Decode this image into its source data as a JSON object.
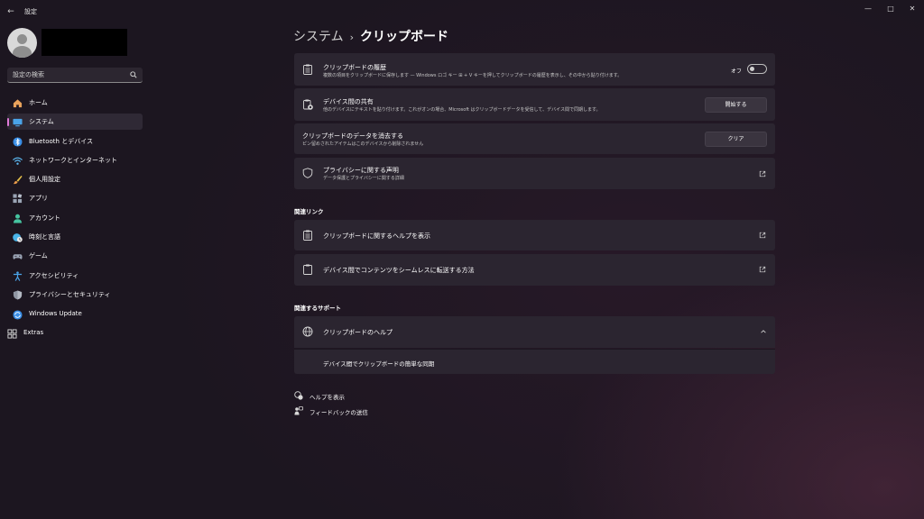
{
  "window": {
    "title": "設定",
    "back": "←",
    "minimize": "—",
    "maximize": "□",
    "close": "✕"
  },
  "search": {
    "placeholder": "設定の検索"
  },
  "sidebar": {
    "items": [
      {
        "label": "ホーム",
        "icon": "home-icon",
        "color": "#e8a25c"
      },
      {
        "label": "システム",
        "icon": "system-icon",
        "color": "#4aa3e8",
        "active": true
      },
      {
        "label": "Bluetooth とデバイス",
        "icon": "bluetooth-icon",
        "color": "#3a8ee6"
      },
      {
        "label": "ネットワークとインターネット",
        "icon": "network-icon",
        "color": "#5cb8f0"
      },
      {
        "label": "個人用設定",
        "icon": "brush-icon",
        "color": "#e89a4a"
      },
      {
        "label": "アプリ",
        "icon": "apps-icon",
        "color": "#9aa4b4"
      },
      {
        "label": "アカウント",
        "icon": "account-icon",
        "color": "#46c4a0"
      },
      {
        "label": "時刻と言語",
        "icon": "globe-clock-icon",
        "color": "#4ab4e8"
      },
      {
        "label": "ゲーム",
        "icon": "game-icon",
        "color": "#9aa4b4"
      },
      {
        "label": "アクセシビリティ",
        "icon": "accessibility-icon",
        "color": "#4aa3e8"
      },
      {
        "label": "プライバシーとセキュリティ",
        "icon": "shield-icon",
        "color": "#8f96a3"
      },
      {
        "label": "Windows Update",
        "icon": "update-icon",
        "color": "#3a8ee6"
      },
      {
        "label": "Extras",
        "icon": "extras-icon",
        "color": "#d8d8d8"
      }
    ]
  },
  "page": {
    "breadcrumb_parent": "システム",
    "breadcrumb_sep": "›",
    "title": "クリップボード"
  },
  "cards": {
    "history": {
      "title": "クリップボードの履歴",
      "desc": "複数の項目をクリップボードに保存します — Windows ロゴ キー ⊞ + V キーを押してクリップボードの履歴を表示し、その中から貼り付けます。",
      "toggle_label": "オフ",
      "toggle_on": false
    },
    "share": {
      "title": "デバイス間の共有",
      "desc": "他のデバイスにテキストを貼り付けます。これがオンの場合、Microsoft はクリップボードデータを受信して、デバイス間で同期します。",
      "button": "開始する"
    },
    "clear": {
      "title": "クリップボードのデータを消去する",
      "desc": "ピン留めされたアイテムはこのデバイスから削除されません",
      "button": "クリア"
    },
    "privacy": {
      "title": "プライバシーに関する声明",
      "desc": "データ保護とプライバシーに関する詳細"
    }
  },
  "related_links": {
    "header": "関連リンク",
    "items": [
      {
        "label": "クリップボードに関するヘルプを表示"
      },
      {
        "label": "デバイス間でコンテンツをシームレスに転送する方法"
      }
    ]
  },
  "related_support": {
    "header": "関連するサポート",
    "help_title": "クリップボードのヘルプ",
    "help_sub": "デバイス間でクリップボードの簡単な同期"
  },
  "footer": {
    "get_help": "ヘルプを表示",
    "feedback": "フィードバックの送信"
  }
}
